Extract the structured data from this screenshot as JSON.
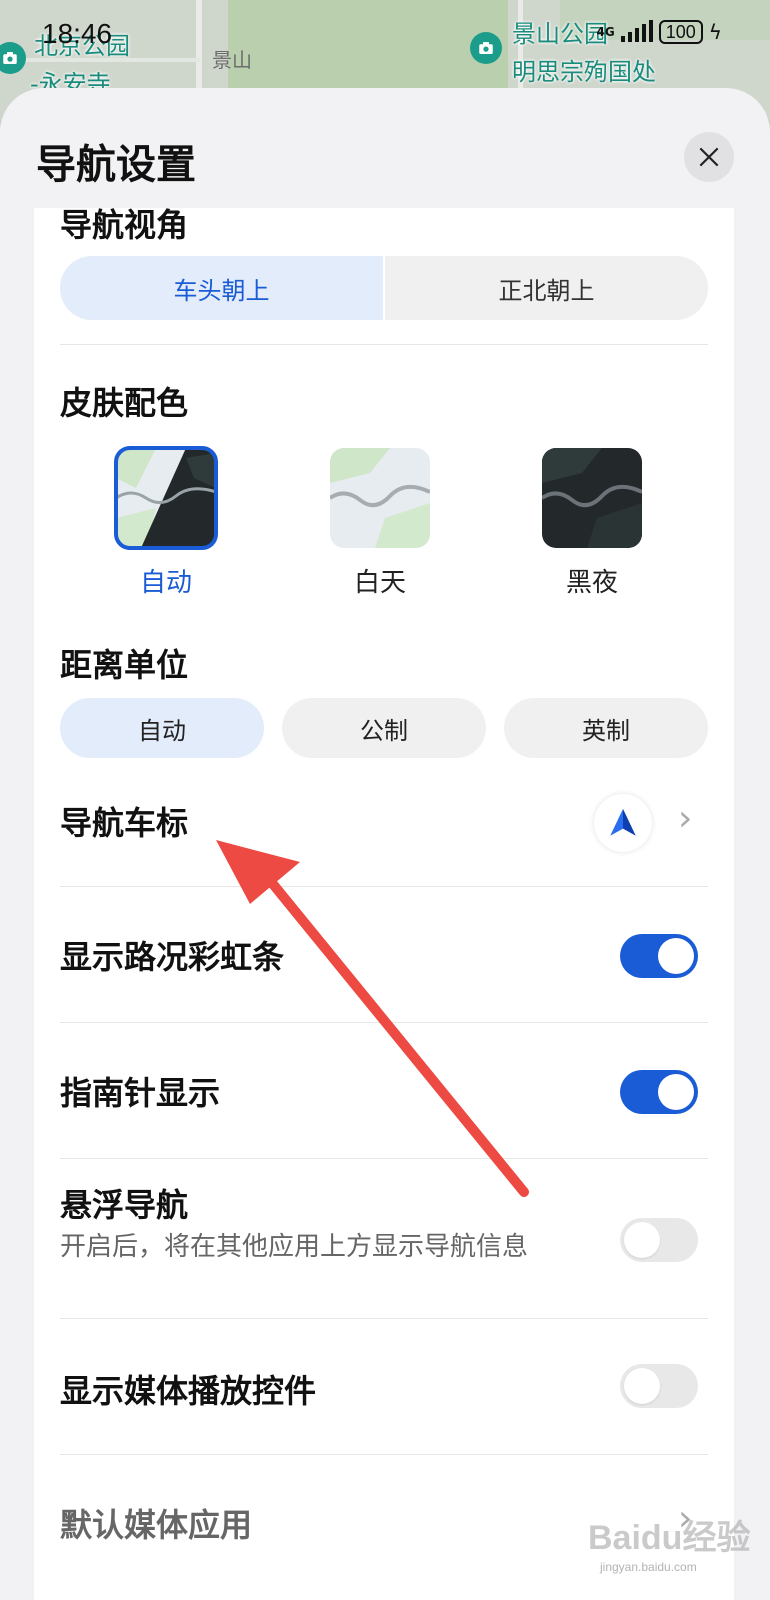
{
  "status_bar": {
    "time": "18:46",
    "signal_label": "4G",
    "battery": "100"
  },
  "map": {
    "labels": [
      "北京公园",
      "-永安寺",
      "景山公园",
      "明思宗殉国处"
    ],
    "road_label": "景山"
  },
  "sheet": {
    "title": "导航设置"
  },
  "nav_view": {
    "title": "导航视角",
    "options": [
      "车头朝上",
      "正北朝上"
    ],
    "selected": "车头朝上"
  },
  "skin": {
    "title": "皮肤配色",
    "options": [
      "自动",
      "白天",
      "黑夜"
    ],
    "selected": "自动"
  },
  "distance_unit": {
    "title": "距离单位",
    "options": [
      "自动",
      "公制",
      "英制"
    ],
    "selected": "自动"
  },
  "settings": {
    "car_icon": {
      "label": "导航车标"
    },
    "traffic_rainbow": {
      "label": "显示路况彩虹条",
      "enabled": true
    },
    "compass": {
      "label": "指南针显示",
      "enabled": true
    },
    "floating_nav": {
      "label": "悬浮导航",
      "sub": "开启后，将在其他应用上方显示导航信息",
      "enabled": false
    },
    "media_controls": {
      "label": "显示媒体播放控件",
      "enabled": false
    },
    "default_media_app": {
      "label": "默认媒体应用"
    }
  },
  "colors": {
    "accent": "#1a5bd6",
    "annotation_arrow": "#ec4a43"
  },
  "watermark": {
    "text": "Baidu经验",
    "sub": "jingyan.baidu.com"
  }
}
